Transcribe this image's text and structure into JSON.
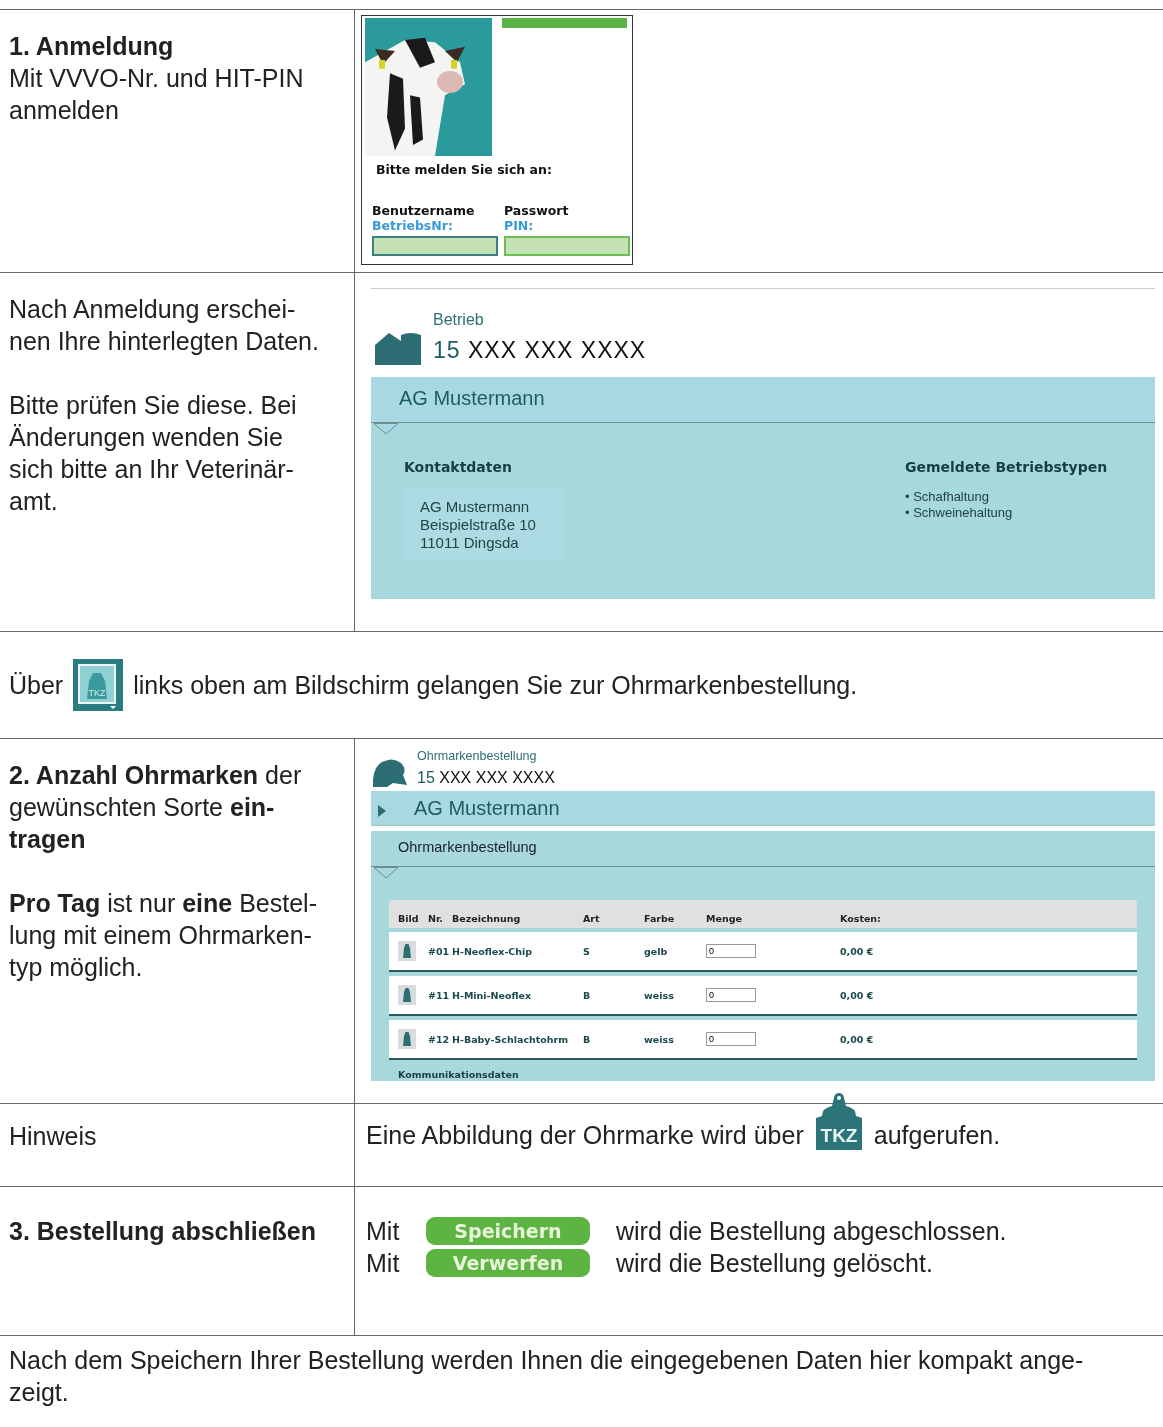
{
  "login_row": {
    "title": "1. Anmeldung",
    "text": "Mit VVVO-Nr. und HIT-PIN\nanmelden",
    "screen": {
      "prompt": "Bitte melden Sie sich an:",
      "fields": [
        {
          "label": "Benutzername",
          "hint": "BetriebsNr:",
          "focused": true
        },
        {
          "label": "Passwort",
          "hint": "PIN:",
          "focused": false
        }
      ]
    }
  },
  "data_row": {
    "paragraphs": [
      "Nach Anmeldung erschei-\nnen Ihre hinterlegten Daten.",
      "Bitte prüfen Sie diese. Bei\nÄnderungen wenden Sie\nsich bitte an Ihr Veterinär-\namt."
    ],
    "screen": {
      "caption": "Betrieb",
      "number_prefix": "15",
      "number": "XXX XXX XXXX",
      "holder": "AG Mustermann",
      "contact_heading": "Kontaktdaten",
      "address": [
        "AG Mustermann",
        "Beispielstraße 10",
        "11011 Dingsda"
      ],
      "types_heading": "Gemeldete Betriebstypen",
      "types": [
        {
          "bullet": "•",
          "name": "Schafhaltung"
        },
        {
          "bullet": "•",
          "name": "Schweinehaltung"
        }
      ]
    }
  },
  "note_row": {
    "before": "Über",
    "icon_label": "TKZ",
    "after": "links oben am Bildschirm gelangen Sie zur Ohrmarkenbestellung."
  },
  "order_row": {
    "text": "**2. Anzahl Ohrmarken** der\ngewünschten Sorte **ein-**\n**tragen**",
    "text2": "**Pro Tag** ist nur **eine** Bestel-\nlung mit einem Ohrmarken-\ntyp möglich.",
    "screen": {
      "caption": "Ohrmarkenbestellung",
      "number_prefix": "15",
      "number": "XXX XXX XXXX",
      "holder": "AG Mustermann",
      "section": "Ohrmarkenbestellung",
      "columns": [
        "Bild",
        "Nr.",
        "Bezeichnung",
        "Art",
        "Farbe",
        "Menge",
        "Kosten:"
      ],
      "rows": [
        {
          "nr": "#01",
          "name": "H-Neoflex-Chip",
          "art": "S",
          "farbe": "gelb",
          "menge": "0",
          "kosten": "0,00 €"
        },
        {
          "nr": "#11",
          "name": "H-Mini-Neoflex",
          "art": "B",
          "farbe": "weiss",
          "menge": "0",
          "kosten": "0,00 €"
        },
        {
          "nr": "#12",
          "name": "H-Baby-Schlachtohrm",
          "art": "B",
          "farbe": "weiss",
          "menge": "0",
          "kosten": "0,00 €"
        }
      ],
      "footer": "Kommunikationsdaten"
    }
  },
  "hint_row": {
    "label": "Hinweis",
    "before": "Eine Abbildung der Ohrmarke wird über",
    "icon_label": "TKZ",
    "after": "aufgerufen."
  },
  "finish_row": {
    "title": "3. Bestellung abschließen",
    "lines": [
      {
        "before": "Mit",
        "button": "Speichern",
        "after": "wird die Bestellung abgeschlossen."
      },
      {
        "before": "Mit",
        "button": "Verwerfen",
        "after": "wird die Bestellung gelöscht."
      }
    ]
  },
  "footer": "Nach dem Speichern Ihrer Bestellung werden Ihnen die eingegebenen Daten hier kompakt ange-\nzeigt."
}
